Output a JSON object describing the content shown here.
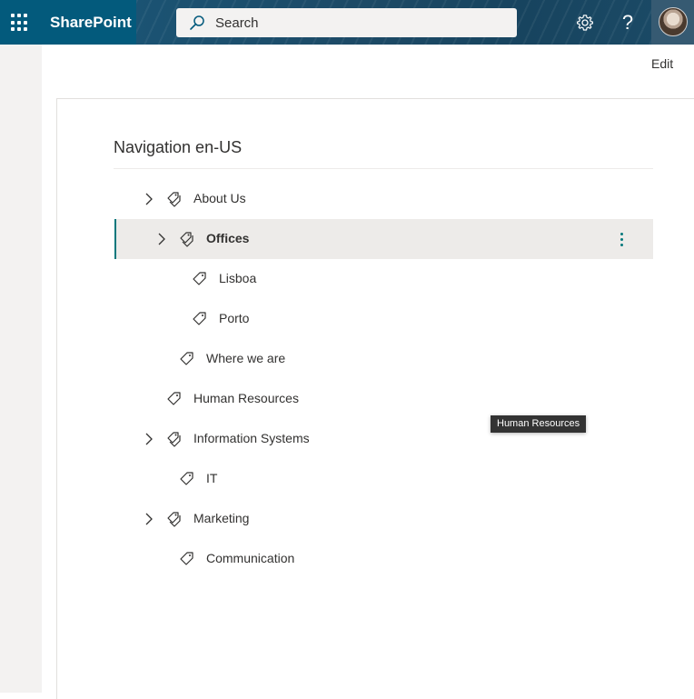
{
  "header": {
    "app_name": "SharePoint",
    "search_placeholder": "Search",
    "help_glyph": "?",
    "icons": [
      "waffle-icon",
      "search-icon",
      "gear-icon",
      "help-icon",
      "avatar"
    ],
    "colors": {
      "suite_bar": "#035a7c",
      "accent": "#03787c"
    }
  },
  "page": {
    "edit_label": "Edit",
    "navigation_title": "Navigation en-US",
    "tooltip": "Human Resources"
  },
  "nav": {
    "items": [
      {
        "label": "About Us",
        "level": 0,
        "expandable": true,
        "selected": false
      },
      {
        "label": "Offices",
        "level": 1,
        "expandable": true,
        "selected": true
      },
      {
        "label": "Lisboa",
        "level": 2,
        "expandable": false,
        "selected": false
      },
      {
        "label": "Porto",
        "level": 2,
        "expandable": false,
        "selected": false
      },
      {
        "label": "Where we are",
        "level": 1,
        "expandable": false,
        "selected": false
      },
      {
        "label": "Human Resources",
        "level": 0,
        "expandable": false,
        "selected": false
      },
      {
        "label": "Information Systems",
        "level": 0,
        "expandable": true,
        "selected": false
      },
      {
        "label": "IT",
        "level": 1,
        "expandable": false,
        "selected": false
      },
      {
        "label": "Marketing",
        "level": 0,
        "expandable": true,
        "selected": false
      },
      {
        "label": "Communication",
        "level": 1,
        "expandable": false,
        "selected": false
      }
    ]
  }
}
